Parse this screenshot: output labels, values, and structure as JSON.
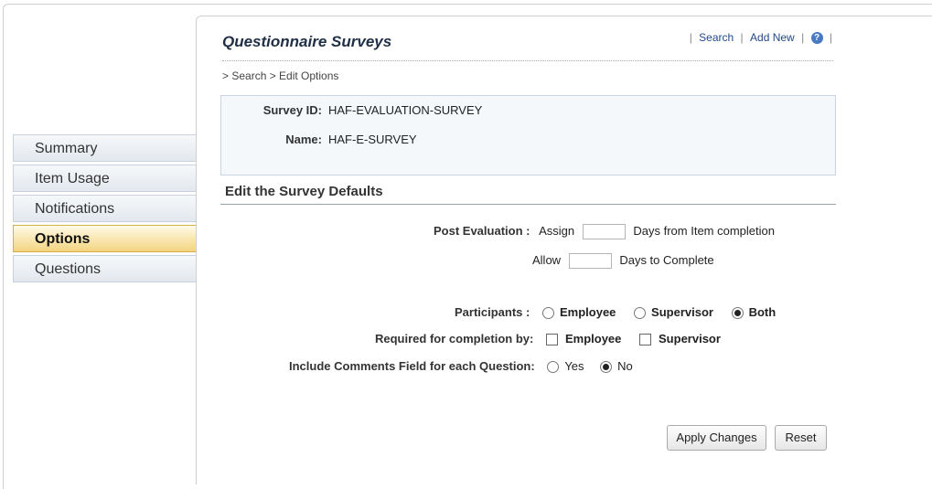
{
  "sidebar": {
    "items": [
      {
        "label": "Summary"
      },
      {
        "label": "Item Usage"
      },
      {
        "label": "Notifications"
      },
      {
        "label": "Options"
      },
      {
        "label": "Questions"
      }
    ],
    "active": "Options"
  },
  "header": {
    "title": "Questionnaire Surveys",
    "links": {
      "search": "Search",
      "add_new": "Add New",
      "help": "?"
    }
  },
  "breadcrumb": "> Search > Edit Options",
  "info": {
    "survey_id_label": "Survey ID:",
    "survey_id_value": "HAF-EVALUATION-SURVEY",
    "name_label": "Name:",
    "name_value": "HAF-E-SURVEY"
  },
  "section": {
    "title": "Edit the Survey Defaults"
  },
  "post_evaluation": {
    "label": "Post Evaluation :",
    "assign_label": "Assign",
    "assign_value": "",
    "assign_suffix": "Days from Item completion",
    "allow_label": "Allow",
    "allow_value": "",
    "allow_suffix": "Days to Complete"
  },
  "participants": {
    "label": "Participants :",
    "options": [
      "Employee",
      "Supervisor",
      "Both"
    ],
    "selected": "Both"
  },
  "required": {
    "label": "Required for completion by:",
    "options": [
      "Employee",
      "Supervisor"
    ],
    "checked": []
  },
  "comments": {
    "label": "Include Comments Field for each Question:",
    "options": [
      "Yes",
      "No"
    ],
    "selected": "No"
  },
  "buttons": {
    "apply": "Apply Changes",
    "reset": "Reset"
  }
}
